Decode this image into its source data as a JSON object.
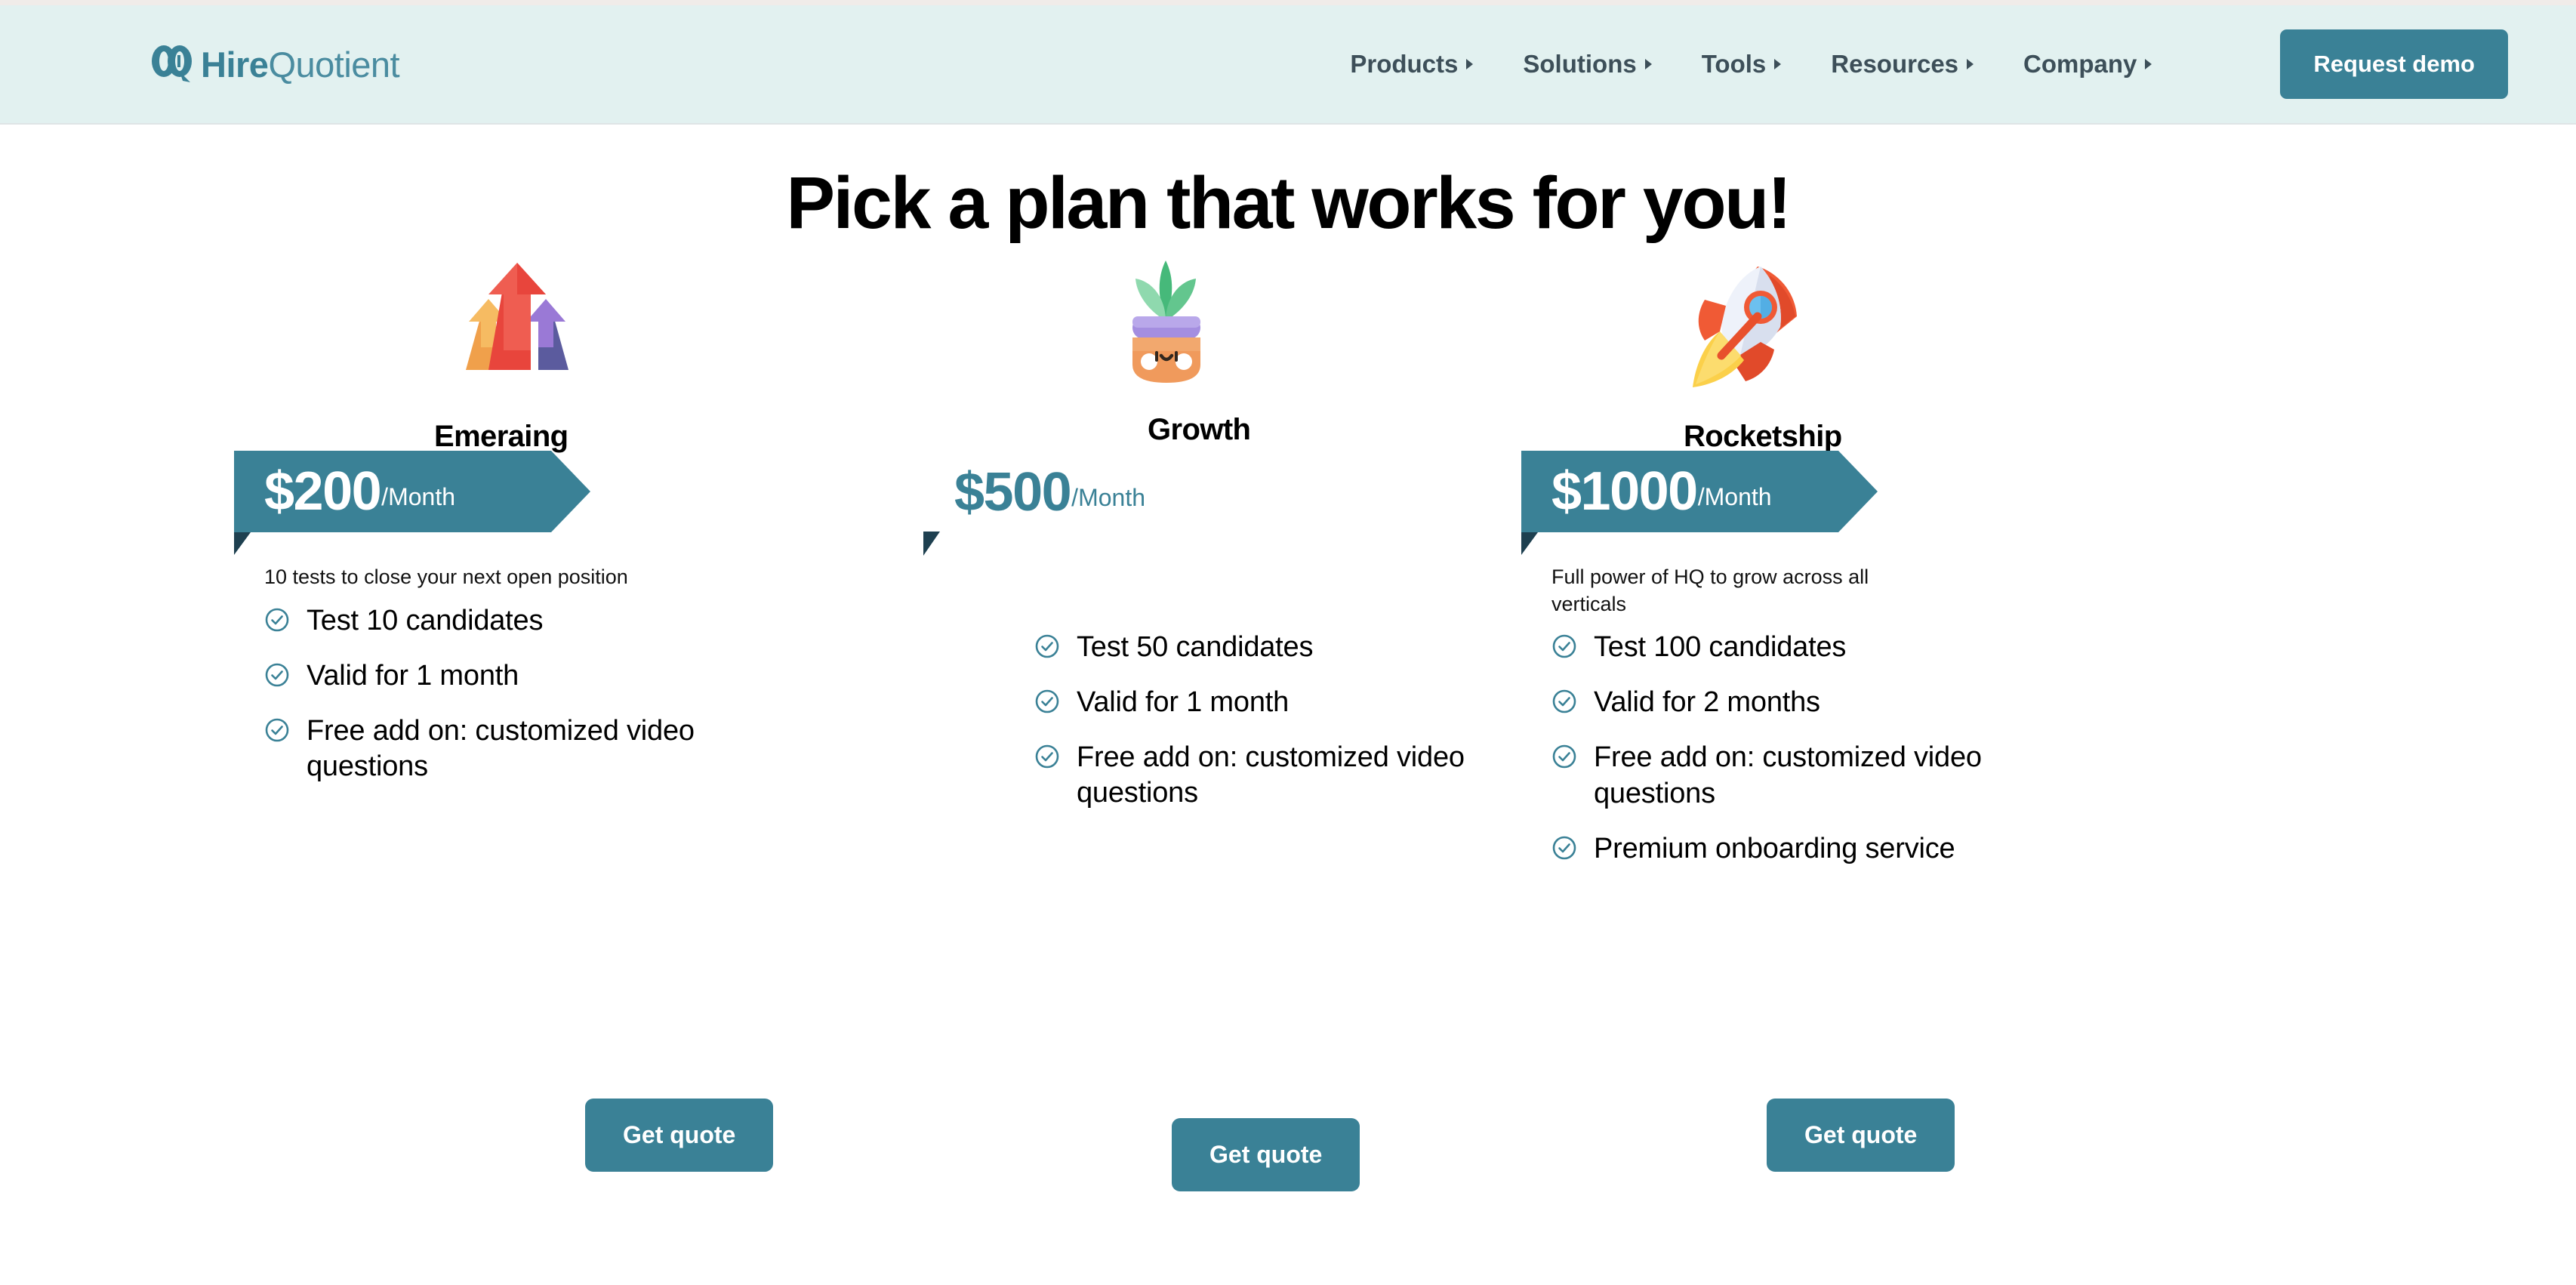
{
  "header": {
    "logo": {
      "mark": "hq-monogram-icon",
      "bold_part": "Hire",
      "light_part": "Quotient"
    },
    "nav_items": [
      {
        "label": "Products",
        "caret": "caret-right-icon"
      },
      {
        "label": "Solutions",
        "caret": "caret-right-icon"
      },
      {
        "label": "Tools",
        "caret": "caret-right-icon"
      },
      {
        "label": "Resources",
        "caret": "caret-right-icon"
      },
      {
        "label": "Company",
        "caret": "caret-right-icon"
      }
    ],
    "cta_label": "Request demo",
    "background_color": "#E2F1F0",
    "accent_color": "#3A8196"
  },
  "page_title": "Pick a plan that works for you!",
  "plans": [
    {
      "icon": "growth-arrows-icon",
      "name": "Emeraing",
      "price_amount": "$200",
      "price_period": "/Month",
      "ribbon_style": "filled",
      "subtitle": "10 tests to close your next open position",
      "features": [
        "Test 10 candidates",
        "Valid for 1 month",
        "Free add on: customized video questions"
      ],
      "cta_label": "Get quote"
    },
    {
      "icon": "potted-plant-icon",
      "name": "Growth",
      "price_amount": "$500",
      "price_period": "/Month",
      "ribbon_style": "plain",
      "subtitle": "",
      "features": [
        "Test 50 candidates",
        "Valid for 1 month",
        "Free add on: customized video questions"
      ],
      "cta_label": "Get quote"
    },
    {
      "icon": "rocket-icon",
      "name": "Rocketship",
      "price_amount": "$1000",
      "price_period": "/Month",
      "ribbon_style": "filled",
      "subtitle": "Full power of HQ to grow across all verticals",
      "features": [
        "Test 100 candidates",
        "Valid for 2 months",
        "Free add on: customized video questions",
        "Premium onboarding service"
      ],
      "cta_label": "Get quote"
    }
  ],
  "colors": {
    "teal": "#3A8196",
    "teal_dark_fold": "#1E4050",
    "header_bg": "#E2F1F0",
    "page_bg": "#FFFFFF",
    "text": "#000000"
  }
}
